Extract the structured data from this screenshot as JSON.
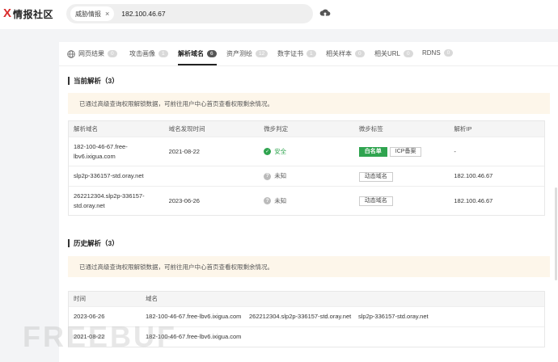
{
  "header": {
    "logo_mark": "X",
    "logo_text": "情报社区",
    "search_chip": "威胁情报",
    "search_chip_close": "×",
    "search_value": "182.100.46.67"
  },
  "tabs": [
    {
      "label": "网页结果",
      "count": "0"
    },
    {
      "label": "攻击画像",
      "count": "1"
    },
    {
      "label": "解析域名",
      "count": "6"
    },
    {
      "label": "资产测绘",
      "count": "12"
    },
    {
      "label": "数字证书",
      "count": "1"
    },
    {
      "label": "相关样本",
      "count": "0"
    },
    {
      "label": "相关URL",
      "count": "0"
    },
    {
      "label": "RDNS",
      "count": "0"
    }
  ],
  "current": {
    "title": "当前解析（3）",
    "notice": "已通过高级查询权限解锁数据，可前往用户中心首页查看权限剩余情况。",
    "headers": [
      "解析域名",
      "域名发现时间",
      "微步判定",
      "微步标签",
      "解析IP"
    ],
    "rows": [
      {
        "domain": "182-100-46-67.free-lbv6.ixigua.com",
        "time": "2021-08-22",
        "verdict": "安全",
        "tags": [
          "白名单",
          "ICP备案"
        ],
        "ip": "-"
      },
      {
        "domain": "slp2p-336157-std.oray.net",
        "time": "",
        "verdict": "未知",
        "tags": [
          "动态域名"
        ],
        "ip": "182.100.46.67"
      },
      {
        "domain": "262212304.slp2p-336157-std.oray.net",
        "time": "2023-06-26",
        "verdict": "未知",
        "tags": [
          "动态域名"
        ],
        "ip": "182.100.46.67"
      }
    ]
  },
  "history": {
    "title": "历史解析（3）",
    "notice": "已通过高级查询权限解锁数据，可前往用户中心首页查看权限剩余情况。",
    "headers": [
      "时间",
      "域名"
    ],
    "rows": [
      {
        "time": "2023-06-26",
        "d1": "182-100-46-67.free-lbv6.ixigua.com",
        "d2": "262212304.slp2p-336157-std.oray.net",
        "d3": "slp2p-336157-std.oray.net"
      },
      {
        "time": "2021-08-22",
        "d1": "182-100-46-67.free-lbv6.ixigua.com",
        "d2": "",
        "d3": ""
      }
    ]
  },
  "watermark": "FREEBUF",
  "colors": {
    "safe": "#2fa44f",
    "notice_bg": "#fdf6ea",
    "brand": "#d92b2b"
  }
}
